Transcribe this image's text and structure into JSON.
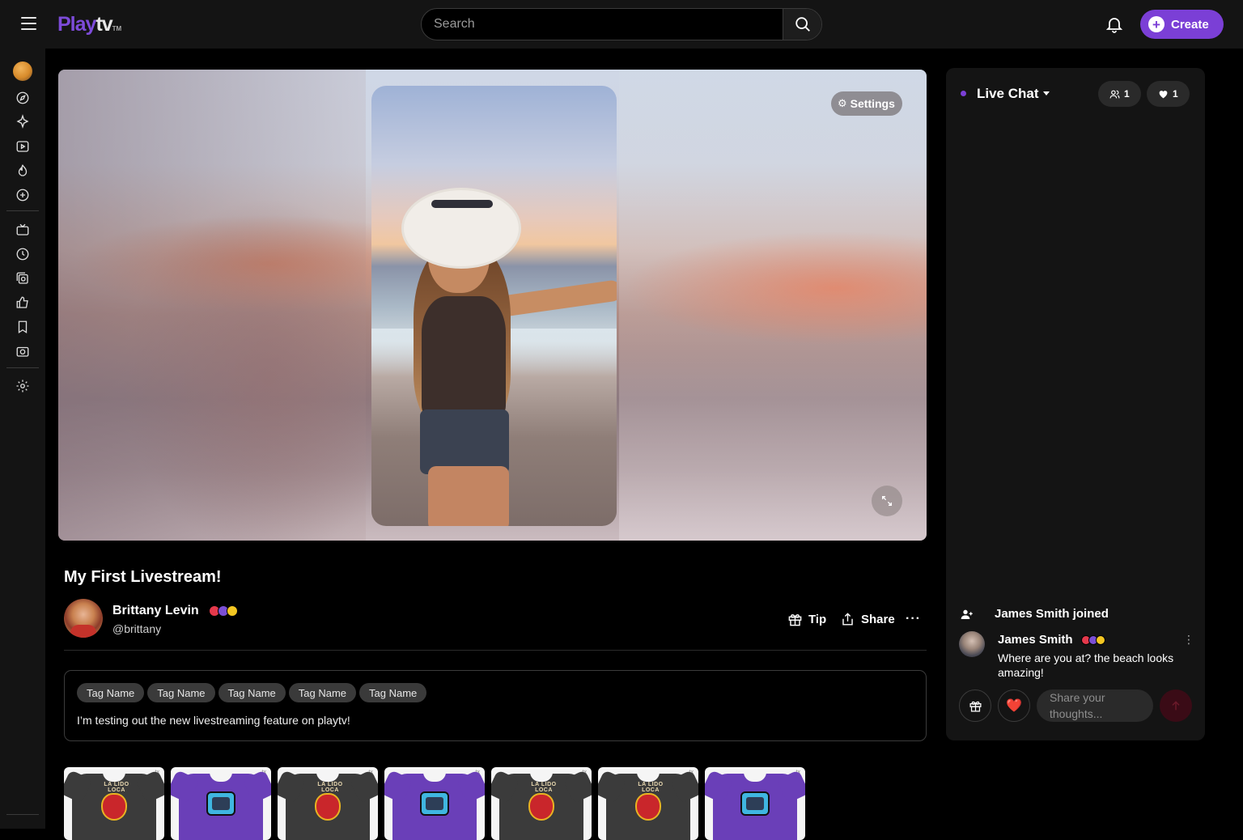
{
  "header": {
    "logo_play": "Play",
    "logo_tv": "tv",
    "logo_mark": "TM",
    "search_placeholder": "Search",
    "create_label": "Create",
    "create_icon": "+"
  },
  "sidebar": {
    "items": [
      {
        "name": "avatar"
      },
      {
        "name": "explore-icon"
      },
      {
        "name": "sparkle-icon"
      },
      {
        "name": "play-icon"
      },
      {
        "name": "fire-icon"
      },
      {
        "name": "add-circle-icon"
      },
      {
        "name": "tv-icon"
      },
      {
        "name": "history-icon"
      },
      {
        "name": "collection-icon"
      },
      {
        "name": "like-icon"
      },
      {
        "name": "bookmark-icon"
      },
      {
        "name": "camera-icon"
      },
      {
        "name": "gear-icon"
      }
    ]
  },
  "player": {
    "settings_label": "Settings",
    "settings_icon": "⚙"
  },
  "stream": {
    "title": "My First Livestream!",
    "host_name": "Brittany Levin",
    "host_handle": "@brittany",
    "tip_label": "Tip",
    "share_label": "Share",
    "more_label": "···",
    "tags": [
      "Tag Name",
      "Tag Name",
      "Tag Name",
      "Tag Name",
      "Tag Name"
    ],
    "description": "I’m testing out the new livestreaming feature on playtv!"
  },
  "merch": {
    "items": [
      {
        "color": "#3b3b3b",
        "print": "la-lido-loca",
        "print_text": "LA LIDO LOCA",
        "brand": "tx"
      },
      {
        "color": "#6a3fb8",
        "print": "tv-graphic",
        "brand": "tx"
      },
      {
        "color": "#3b3b3b",
        "print": "la-lido-loca",
        "print_text": "LA LIDO LOCA",
        "brand": "tx"
      },
      {
        "color": "#6a3fb8",
        "print": "tv-graphic",
        "brand": "tx"
      },
      {
        "color": "#3b3b3b",
        "print": "la-lido-loca",
        "print_text": "LA LIDO LOCA",
        "brand": "tx"
      },
      {
        "color": "#3b3b3b",
        "print": "la-lido-loca",
        "print_text": "LA LIDO LOCA",
        "brand": "tx"
      },
      {
        "color": "#6a3fb8",
        "print": "tv-graphic",
        "brand": "tx"
      }
    ]
  },
  "chat": {
    "title": "Live Chat",
    "viewers_count": "1",
    "likes_count": "1",
    "join_text": "James Smith joined",
    "message": {
      "user": "James Smith",
      "text": "Where are you at? the beach looks amazing!"
    },
    "input_placeholder": "Share your thoughts...",
    "heart_emoji": "❤️"
  },
  "colors": {
    "accent": "#7b3fd6",
    "background": "#000000",
    "panel": "#141414"
  }
}
